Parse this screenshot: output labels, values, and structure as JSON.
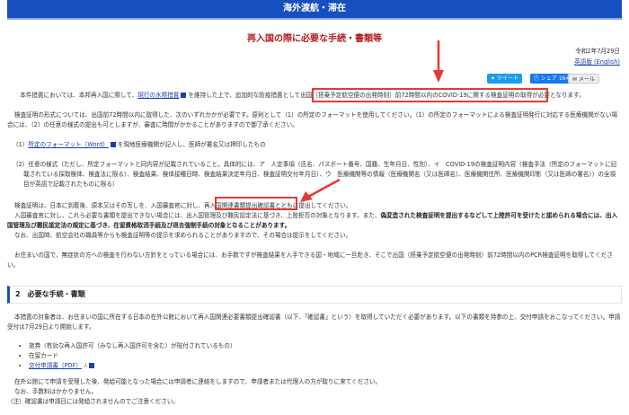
{
  "header": {
    "section": "海外渡航・滞在"
  },
  "page": {
    "title": "再入国の際に必要な手続・書類等",
    "date": "令和2年7月29日",
    "english_link": "英語版 (English)"
  },
  "share": {
    "tweet": "ツイート",
    "facebook": "シェア 164",
    "mail": "メール"
  },
  "content": {
    "p1a": "本件措置においては、本邦再入国に際して、",
    "p1_link": "現行の水際措置",
    "p1b": "を維持した上で、追加的な防疫措置として",
    "p1_highlight": "出国（搭乗予定航空便の出発時刻）前72時間以内のCOVID-19に関する検査証明",
    "p1c": "の取得が必要となります。",
    "p2": "検査証明の形式については、出国前72時間以内に取得した、次のいずれかかが必要です。原則として（1）の所定のフォーマットを使用してください。（1）の所定のフォーマットによる検査証明発行に対応する医療機関がない場合には、（2）の任意の様式の提出も可としますが、審査に時間がかかることがありますので御了承ください。",
    "item1_prefix": "（1）",
    "item1_link": "所定のフォーマット（Word）",
    "item1_text": "を現地医療機関が記入し、医師が署名又は押印したもの",
    "item2": "（2）任意の様式（ただし、所定フォーマットと同内容が記載されていること。具体的には、ア　人定事項（氏名、パスポート番号、国籍、生年月日、性別）、イ　COVID-19の検査証明内容（検査手法（所定のフォーマットに記載されている採取検体、検査法に限る）、検査結果、検体接種日時、検査結果決定年月日、検査証明交付年月日）、ウ　医療機関等の情報（医療機関名（又は医師名）、医療機関住所、医療機関印影（又は医師の署名））の全項目が英語で記載されたものに限る）",
    "p3a": "検査証明は、日本に到着後、原本又はその写しを、入国審査官に対し、",
    "p3_highlight": "再入国関連書類提出確認書",
    "p3b": "とともに提出してください。",
    "p4a": "入国審査官に対し、これら必要な書類を提出できない場合には、出入国管理及び難民認定法に基づき、上陸拒否の対象となります。また、",
    "p4_bold": "偽変造された検査証明を提出するなどして上陸許可を受けたと認められる場合には、出入国管理及び難民認定法の規定に基づき、在留資格取消手続及び退去強制手続の対象となることがあります。",
    "p5": "なお、出国時、航空会社の職員等からも検査証明等の提示を求められることがありますので、その場合は提示をしてください。",
    "p6": "お住まいの国で、無症状の方への検査を行わない方針をとっている場合には、お手数ですが検査結果を入手できる国・地域に一旦赴き、そこで出国（搭乗予定航空便の出発時刻）前72時間以内のPCR検査証明を取得してください。"
  },
  "section2": {
    "heading": "2　必要な手続・書類",
    "p1": "本措置の対象者は、お住まいの国に所在する日本の在外公館において再入国関連必要書類提出確認書（以下、「確認書」という）を取得していただく必要があります。以下の書類を持参の上、交付申請をおこなってください。申請受付は7月29日より開始します。",
    "items": [
      "旅券（有効な再入国許可（みなし再入国許可を含む）が貼付されているもの）",
      "在留カード"
    ],
    "pdf_link": "交付申請書（PDF）",
    "p2": "在外公館にて申請を受理した後、発給可能となった場合には申請者に連絡をしますので、申請者または代理人の方が取りに来てください。",
    "p3": "なお、手数料はかかりません。",
    "note": "（注）確認書は申請日には発給されませんのでご注意ください。"
  },
  "colors": {
    "header": "#1650c0",
    "title": "#b71c1c",
    "highlight": "#e53935"
  }
}
